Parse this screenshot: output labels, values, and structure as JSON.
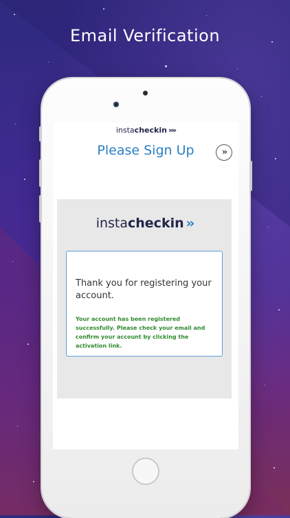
{
  "headline": "Email Verification",
  "app": {
    "logo_light": "insta",
    "logo_bold": "checkin",
    "logo_chevron": "»»"
  },
  "header": {
    "title": "Please Sign Up",
    "next_icon": "double-chevron-right-icon",
    "next_glyph": "››"
  },
  "card": {
    "logo_part1": "insta",
    "logo_part2": "checkin",
    "logo_chevron": "››",
    "message_title": "Thank you for registering your account.",
    "message_body": "Your account has been registered successfully. Please check your email and confirm your account by clicking the activation link."
  },
  "colors": {
    "title_blue": "#2a7fc3",
    "success_green": "#2f8a2f",
    "brand_navy": "#22244a"
  }
}
